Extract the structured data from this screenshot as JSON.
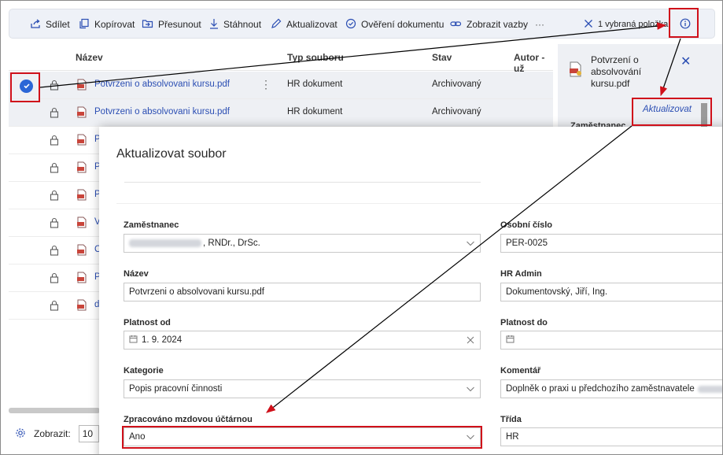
{
  "toolbar": {
    "share": "Sdílet",
    "copy": "Kopírovat",
    "move": "Přesunout",
    "download": "Stáhnout",
    "update": "Aktualizovat",
    "verify": "Ověření dokumentu",
    "links": "Zobrazit vazby",
    "more": "···",
    "selection": "1 vybraná položka"
  },
  "list": {
    "columns": {
      "name": "Název",
      "type": "Typ souboru",
      "state": "Stav",
      "author": "Autor - už"
    },
    "rows": [
      {
        "name": "Potvrzeni o absolvovani kursu.pdf",
        "type": "HR dokument",
        "state": "Archivovaný"
      },
      {
        "name": "Potvrzeni o absolvovani kursu.pdf",
        "type": "HR dokument",
        "state": "Archivovaný"
      },
      {
        "name": "P"
      },
      {
        "name": "P"
      },
      {
        "name": "P"
      },
      {
        "name": "V"
      },
      {
        "name": "C"
      },
      {
        "name": "P"
      },
      {
        "name": "d"
      }
    ]
  },
  "footer": {
    "show_label": "Zobrazit:",
    "page_size": "10"
  },
  "panel": {
    "title": "Potvrzení o absolvování kursu.pdf",
    "action": "Aktualizovat",
    "label": "Zaměstnanec"
  },
  "dialog": {
    "title": "Aktualizovat soubor",
    "fields": {
      "employee": {
        "label": "Zaměstnanec",
        "value": ", RNDr., DrSc."
      },
      "personal_number": {
        "label": "Osobní číslo",
        "value": "PER-0025"
      },
      "name": {
        "label": "Název",
        "value": "Potvrzeni o absolvovani kursu.pdf"
      },
      "hr_admin": {
        "label": "HR Admin",
        "value": "Dokumentovský, Jiří, Ing."
      },
      "valid_from": {
        "label": "Platnost od",
        "value": "1. 9. 2024"
      },
      "valid_to": {
        "label": "Platnost do",
        "value": ""
      },
      "category": {
        "label": "Kategorie",
        "value": "Popis pracovní činnosti"
      },
      "comment": {
        "label": "Komentář",
        "value": "Doplněk o praxi u předchozího zaměstnavatele"
      },
      "payroll": {
        "label": "Zpracováno mzdovou účtárnou",
        "value": "Ano"
      },
      "class": {
        "label": "Třída",
        "value": "HR"
      }
    }
  },
  "colors": {
    "accent": "#2b66d6",
    "link": "#2b4eb3",
    "annotation": "#d0101a"
  }
}
